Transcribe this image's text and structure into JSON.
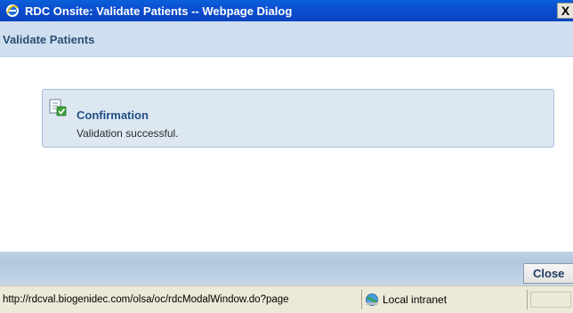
{
  "window": {
    "title": "RDC Onsite: Validate Patients -- Webpage Dialog",
    "close_glyph": "X",
    "title_icon": "ie-icon"
  },
  "header": {
    "title": "Validate Patients"
  },
  "confirmation": {
    "icon": "document-check-icon",
    "title": "Confirmation",
    "message": "Validation successful."
  },
  "footer": {
    "close_label": "Close"
  },
  "statusbar": {
    "url": "http://rdcval.biogenidec.com/olsa/oc/rdcModalWindow.do?page",
    "zone_label": "Local intranet",
    "zone_icon": "local-intranet-icon"
  },
  "colors": {
    "titlebar": "#0a4fd0",
    "header_bg": "#cfdff0",
    "confirm_bg": "#dde7f2",
    "footer_bg": "#b1c7de",
    "statusbar_bg": "#ece9d8"
  }
}
